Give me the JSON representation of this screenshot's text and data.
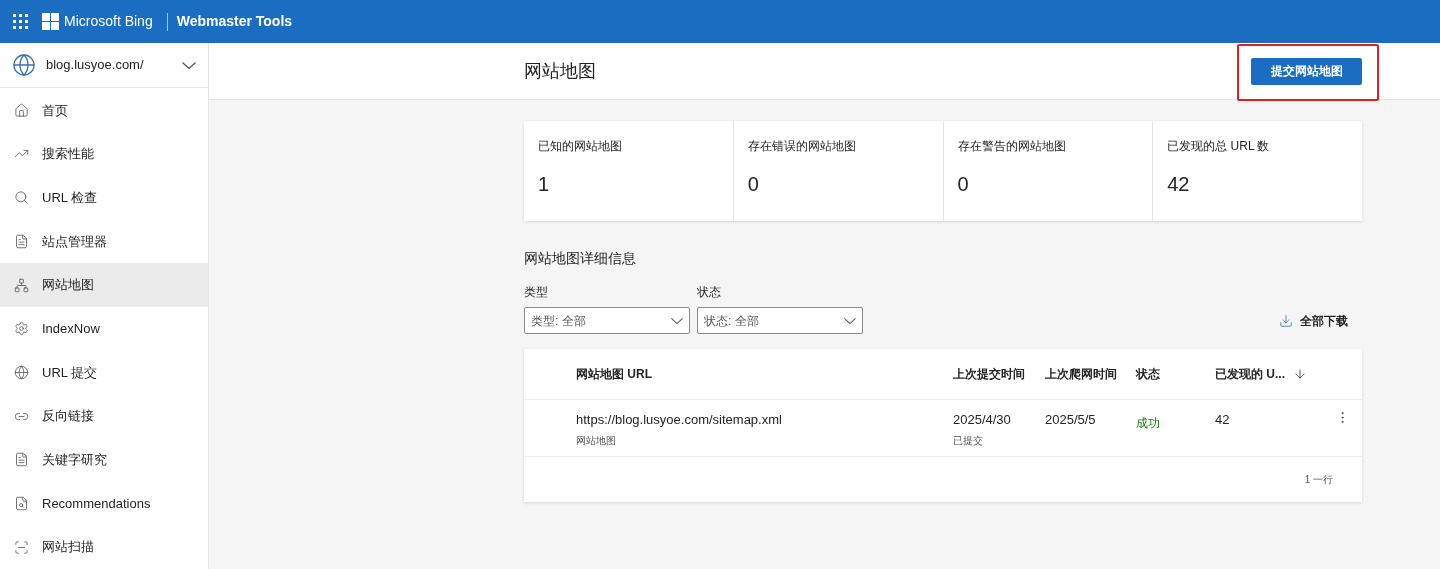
{
  "header": {
    "brand": "Microsoft Bing",
    "product": "Webmaster Tools"
  },
  "site_selector": {
    "value": "blog.lusyoe.com/"
  },
  "sidebar": {
    "items": [
      {
        "label": "首页",
        "selected": false
      },
      {
        "label": "搜索性能",
        "selected": false
      },
      {
        "label": "URL 检查",
        "selected": false
      },
      {
        "label": "站点管理器",
        "selected": false
      },
      {
        "label": "网站地图",
        "selected": true
      },
      {
        "label": "IndexNow",
        "selected": false
      },
      {
        "label": "URL 提交",
        "selected": false
      },
      {
        "label": "反向链接",
        "selected": false
      },
      {
        "label": "关键字研究",
        "selected": false
      },
      {
        "label": "Recommendations",
        "selected": false
      },
      {
        "label": "网站扫描",
        "selected": false
      }
    ]
  },
  "page": {
    "title": "网站地图",
    "submit_button": {
      "label": "提交网站地图",
      "highlighted": true
    }
  },
  "stats": [
    {
      "label": "已知的网站地图",
      "value": "1"
    },
    {
      "label": "存在错误的网站地图",
      "value": "0"
    },
    {
      "label": "存在警告的网站地图",
      "value": "0"
    },
    {
      "label": "已发现的总 URL 数",
      "value": "42"
    }
  ],
  "details": {
    "title": "网站地图详细信息",
    "filters": [
      {
        "label": "类型",
        "value": "类型: 全部"
      },
      {
        "label": "状态",
        "value": "状态: 全部"
      }
    ],
    "download": "全部下载",
    "table": {
      "columns": [
        {
          "label": "网站地图 URL",
          "sorted": false
        },
        {
          "label": "上次提交时间",
          "sorted": false
        },
        {
          "label": "上次爬网时间",
          "sorted": false
        },
        {
          "label": "状态",
          "sorted": false
        },
        {
          "label": "已发现的 U...",
          "sorted": true
        }
      ],
      "rows": [
        {
          "url": "https://blog.lusyoe.com/sitemap.xml",
          "type": "网站地图",
          "submitted": "2025/4/30",
          "submitted_note": "已提交",
          "crawled": "2025/5/5",
          "status": {
            "text": "成功",
            "kind": "success"
          },
          "discovered": "42"
        }
      ],
      "footer": "1 一行"
    }
  }
}
